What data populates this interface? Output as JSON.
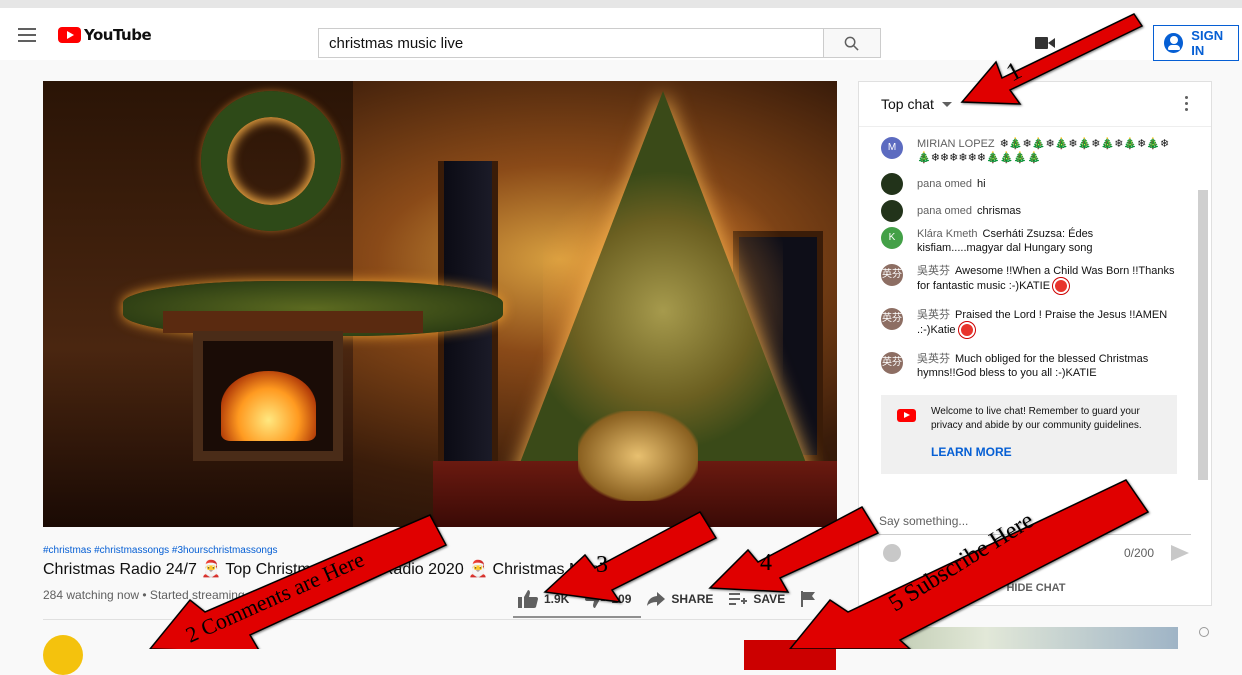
{
  "header": {
    "logo_text": "YouTube",
    "search_value": "christmas music live",
    "signin_label": "SIGN IN"
  },
  "video": {
    "hashtags": "#christmas #christmassongs #3hourschristmassongs",
    "title": "Christmas Radio 24/7 🎅 Top Christmas Songs Radio 2020 🎅 Christmas Music Live",
    "meta": "284 watching now • Started streaming",
    "likes": "1.9K",
    "dislikes": "109",
    "share_label": "SHARE",
    "save_label": "SAVE"
  },
  "chat": {
    "mode_label": "Top chat",
    "messages": [
      {
        "author": "MIRIAN LOPEZ",
        "text": "❄🎄❄🎄❄🎄❄🎄❄🎄❄🎄❄🎄❄ 🎄❄❄❄❄❄❄🎄🎄🎄🎄",
        "initial": "M",
        "color": "#5c6bc0"
      },
      {
        "author": "pana omed",
        "text": "hi",
        "initial": "",
        "color": "#22331a"
      },
      {
        "author": "pana omed",
        "text": "chrismas",
        "initial": "",
        "color": "#22331a"
      },
      {
        "author": "Klára Kmeth",
        "text": "Cserháti Zsuzsa: Édes kisfiam.....magyar dal Hungary song",
        "initial": "K",
        "color": "#43a047"
      },
      {
        "author": "吳英芬",
        "text": "Awesome !!When a Child Was Born !!Thanks for fantastic music :-)KATIE",
        "initial": "英芬",
        "color": "#8d6e63"
      },
      {
        "author": "吳英芬",
        "text": "Praised the Lord ! Praise the Jesus !!AMEN .:-)Katie",
        "initial": "英芬",
        "color": "#8d6e63"
      },
      {
        "author": "吳英芬",
        "text": "Much obliged for the blessed Christmas hymns!!God bless to you all :-)KATIE",
        "initial": "英芬",
        "color": "#8d6e63"
      }
    ],
    "banner_text": "Welcome to live chat! Remember to guard your privacy and abide by our community guidelines.",
    "learn_more": "LEARN MORE",
    "input_placeholder": "Say something...",
    "counter": "0/200",
    "hide_chat": "HIDE CHAT"
  },
  "annotations": [
    {
      "number": "1"
    },
    {
      "text": "2 Comments are Here"
    },
    {
      "number": "3"
    },
    {
      "number": "4"
    },
    {
      "text": "5 Subscribe Here"
    }
  ],
  "colors": {
    "brand_red": "#ff0000",
    "link_blue": "#065fd4",
    "annotation_red": "#e00000"
  }
}
